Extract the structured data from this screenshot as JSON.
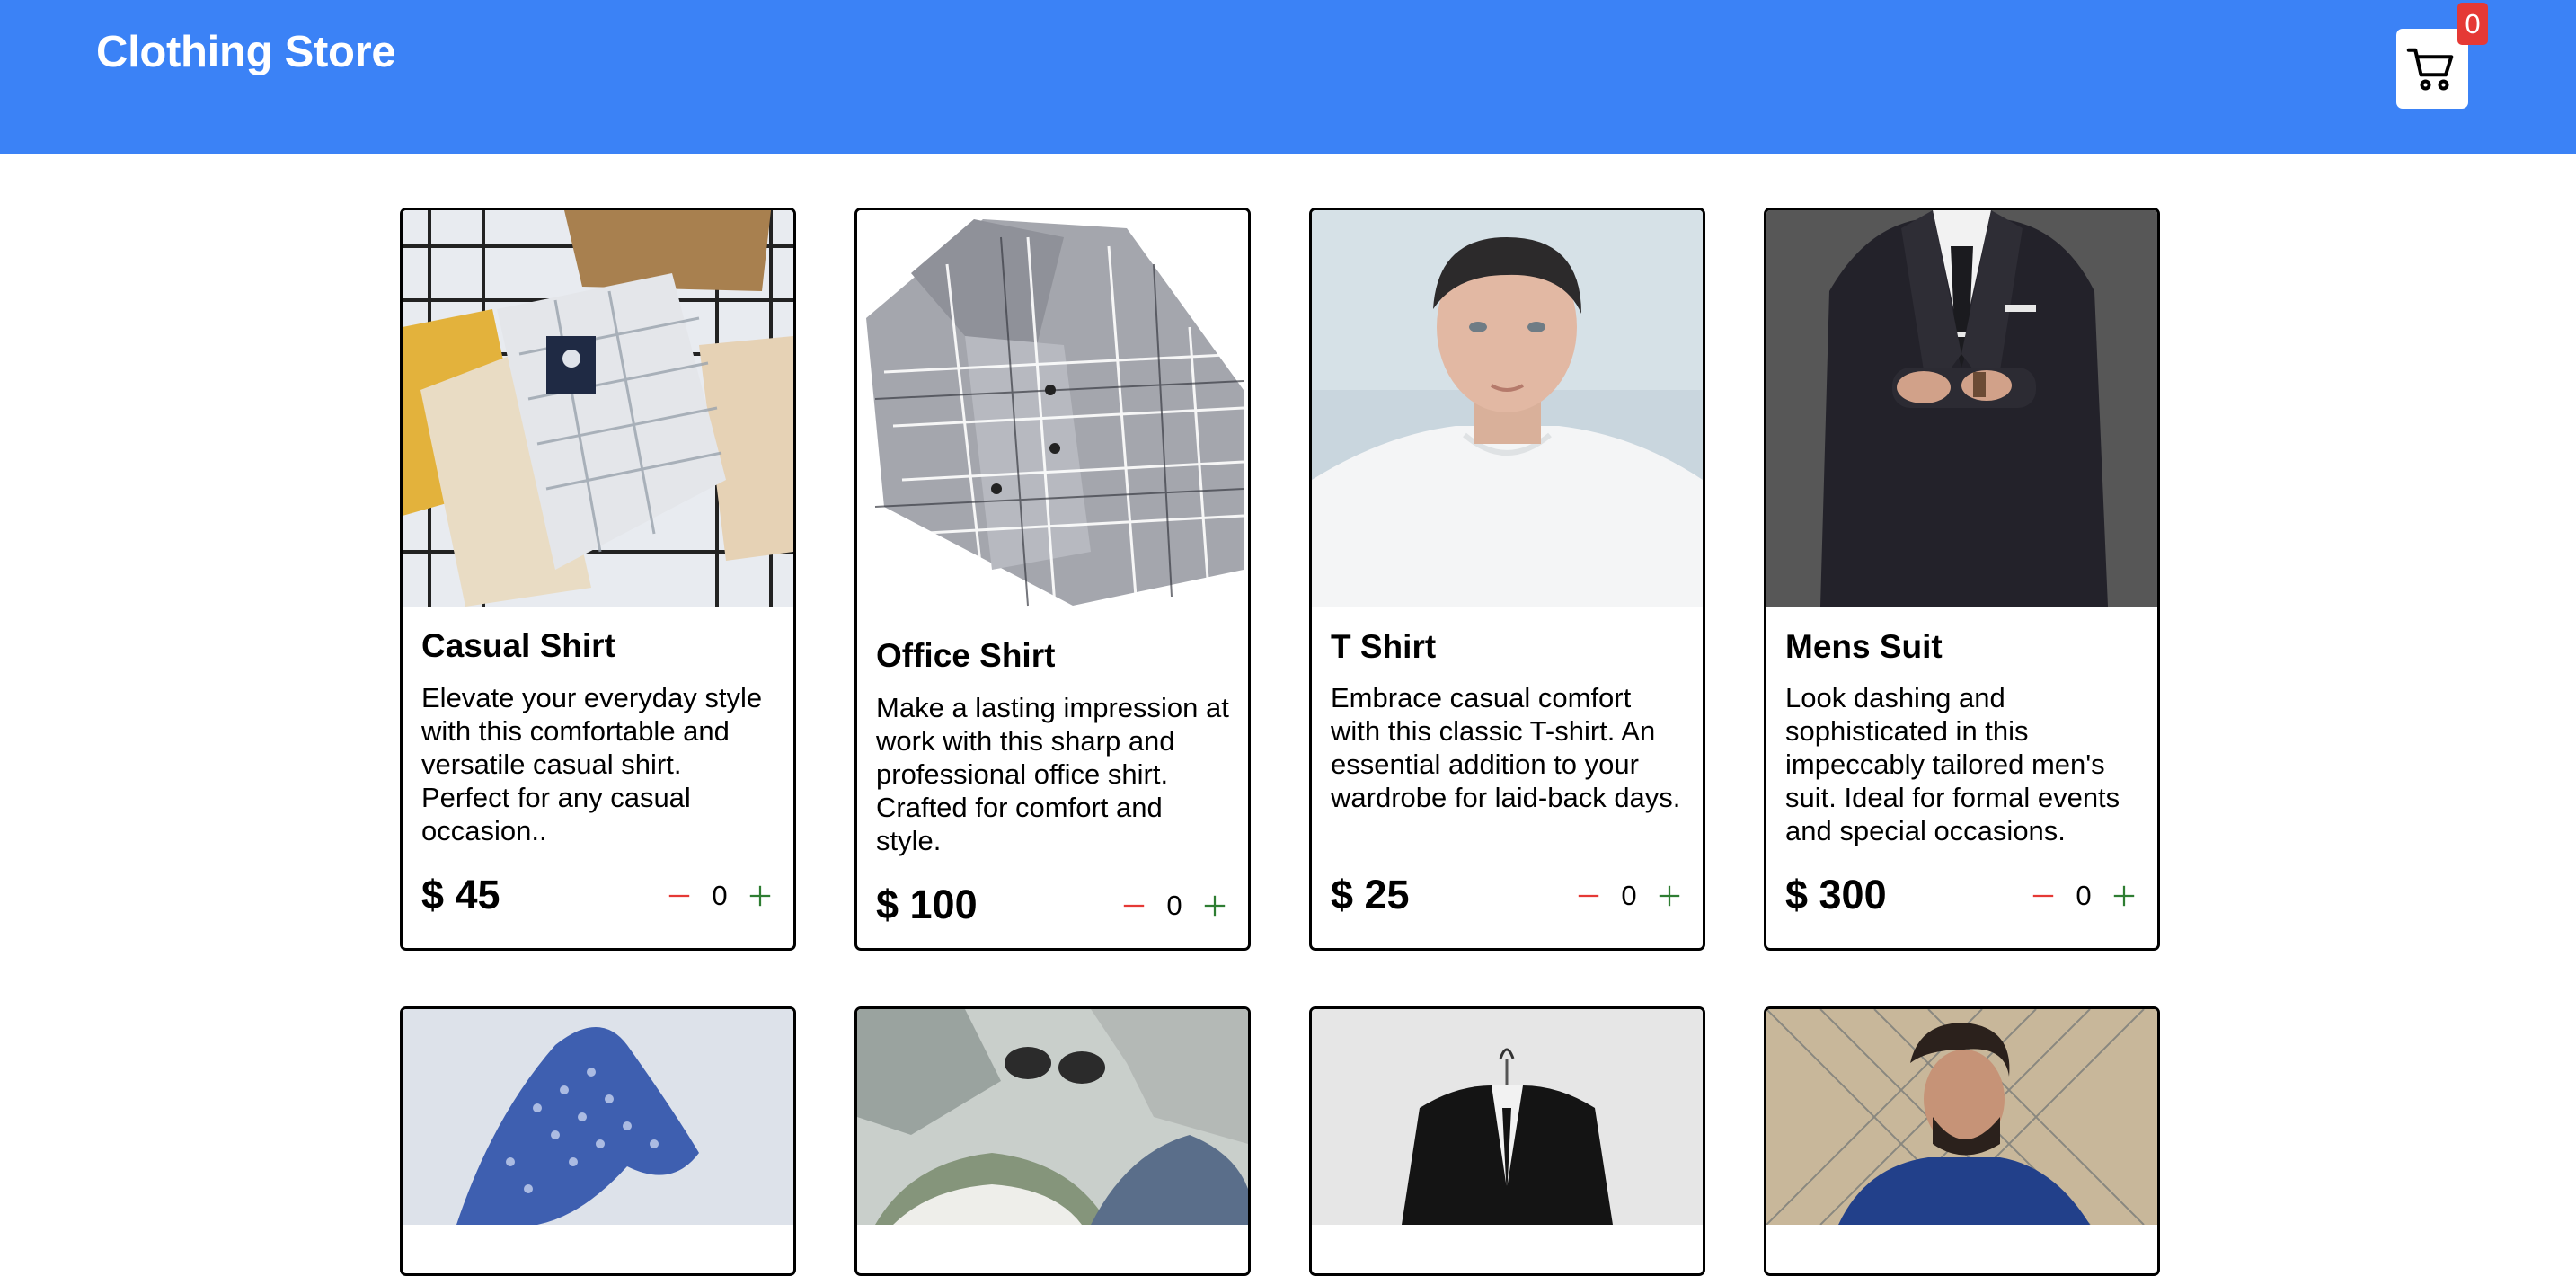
{
  "header": {
    "title": "Clothing Store",
    "cart_icon": "shopping-cart-icon",
    "cart_count": "0"
  },
  "products": [
    {
      "title": "Casual Shirt",
      "description": "Elevate your everyday style with this comfortable and versatile casual shirt. Perfect for any casual occasion..",
      "price": "$ 45",
      "quantity": "0"
    },
    {
      "title": "Office Shirt",
      "description": "Make a lasting impression at work with this sharp and professional office shirt. Crafted for comfort and style.",
      "price": "$ 100",
      "quantity": "0"
    },
    {
      "title": "T Shirt",
      "description": "Embrace casual comfort with this classic T-shirt. An essential addition to your wardrobe for laid-back days.",
      "price": "$ 25",
      "quantity": "0"
    },
    {
      "title": "Mens Suit",
      "description": "Look dashing and sophisticated in this impeccably tailored men's suit. Ideal for formal events and special occasions.",
      "price": "$ 300",
      "quantity": "0"
    }
  ],
  "colors": {
    "header_bg": "#3b82f6",
    "badge_bg": "#e53935",
    "minus": "#e53935",
    "plus": "#2e7d32"
  },
  "icons": {
    "minus": "minus-icon",
    "plus": "plus-icon"
  }
}
